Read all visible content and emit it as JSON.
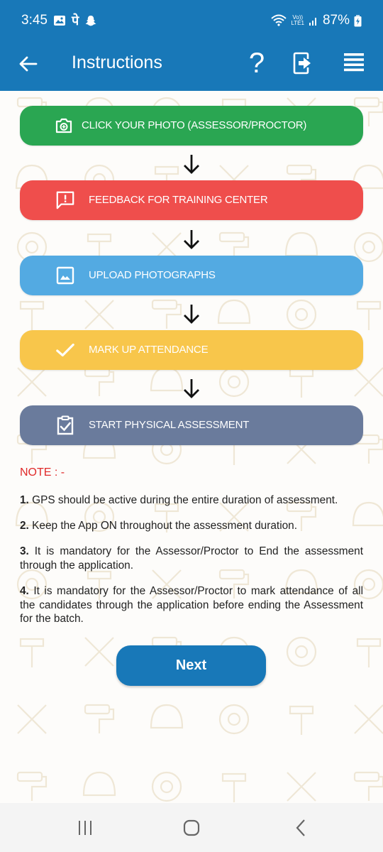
{
  "status_bar": {
    "time": "3:45",
    "left_icons": [
      "gallery-icon",
      "devanagari-app-icon",
      "snapchat-icon"
    ],
    "devanagari_glyph": "पे",
    "right_icons": [
      "wifi-icon",
      "volte-lte-icon",
      "signal-icon",
      "battery-charging-icon"
    ],
    "volte_label_top": "Vo))",
    "volte_label_bottom": "LTE1",
    "battery": "87%"
  },
  "header": {
    "title": "Instructions",
    "back_icon": "back-arrow-icon",
    "help_label": "?",
    "help_icon": "help-icon",
    "logout_icon": "logout-icon",
    "menu_icon": "menu-icon",
    "color": "#1878b8"
  },
  "steps": [
    {
      "label": "CLICK YOUR PHOTO (ASSESSOR/PROCTOR)",
      "icon": "camera-icon",
      "color": "#2aa652"
    },
    {
      "label": "FEEDBACK FOR TRAINING CENTER",
      "icon": "feedback-icon",
      "color": "#ef4e4c"
    },
    {
      "label": "UPLOAD PHOTOGRAPHS",
      "icon": "image-icon",
      "color": "#53aae2"
    },
    {
      "label": "MARK UP ATTENDANCE",
      "icon": "checkmark-icon",
      "color": "#f8c64b"
    },
    {
      "label": "START PHYSICAL ASSESSMENT",
      "icon": "clipboard-check-icon",
      "color": "#6a7b9c"
    }
  ],
  "note": {
    "title": "NOTE : -",
    "title_color": "#e02a2a",
    "items": [
      {
        "num": "1.",
        "text": " GPS should be active during the entire duration of assessment."
      },
      {
        "num": "2.",
        "text": " Keep the App ON throughout the assessment duration."
      },
      {
        "num": "3.",
        "text": " It is mandatory for the Assessor/Proctor to End the assessment through the application."
      },
      {
        "num": "4.",
        "text": " It is mandatory for the Assessor/Proctor to mark attendance of all the candidates through the application before ending the Assessment for the batch."
      }
    ]
  },
  "next_button": {
    "label": "Next"
  },
  "nav_bar": {
    "recents_icon": "recents-icon",
    "home_icon": "home-icon",
    "back_icon": "back-chevron-icon"
  }
}
